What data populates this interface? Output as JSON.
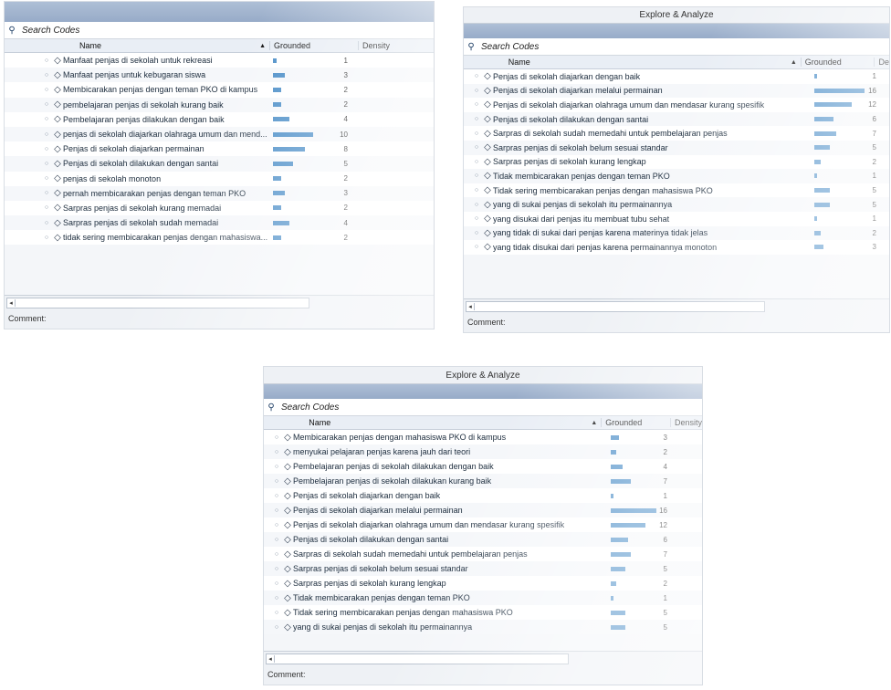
{
  "screenshots": [
    {
      "title": "",
      "search_label": "Search Codes",
      "columns": {
        "name": "Name",
        "grounded": "Grounded",
        "density": "Density"
      },
      "comment_label": "Comment:",
      "rows": [
        {
          "name": "Manfaat penjas di sekolah untuk rekreasi",
          "grounded": 1
        },
        {
          "name": "Manfaat penjas untuk kebugaran siswa",
          "grounded": 3
        },
        {
          "name": "Membicarakan penjas dengan teman PKO di kampus",
          "grounded": 2
        },
        {
          "name": "pembelajaran penjas di sekolah kurang baik",
          "grounded": 2
        },
        {
          "name": "Pembelajaran penjas dilakukan dengan baik",
          "grounded": 4
        },
        {
          "name": "penjas di sekolah diajarkan olahraga umum dan mend...",
          "grounded": 10
        },
        {
          "name": "Penjas di sekolah diajarkan permainan",
          "grounded": 8
        },
        {
          "name": "Penjas di sekolah dilakukan dengan santai",
          "grounded": 5
        },
        {
          "name": "penjas di sekolah monoton",
          "grounded": 2
        },
        {
          "name": "pernah membicarakan penjas dengan teman PKO",
          "grounded": 3
        },
        {
          "name": "Sarpras penjas di sekolah kurang memadai",
          "grounded": 2
        },
        {
          "name": "Sarpras penjas di sekolah sudah memadai",
          "grounded": 4
        },
        {
          "name": "tidak sering membicarakan penjas dengan mahasiswa...",
          "grounded": 2
        }
      ]
    },
    {
      "title": "Explore & Analyze",
      "search_label": "Search Codes",
      "columns": {
        "name": "Name",
        "grounded": "Grounded",
        "density": "De"
      },
      "comment_label": "Comment:",
      "rows": [
        {
          "name": "Penjas di sekolah diajarkan dengan baik",
          "grounded": 1
        },
        {
          "name": "Penjas di sekolah diajarkan melalui permainan",
          "grounded": 16
        },
        {
          "name": "Penjas di sekolah diajarkan olahraga umum dan mendasar kurang spesifik",
          "grounded": 12
        },
        {
          "name": "Penjas di sekolah dilakukan dengan santai",
          "grounded": 6
        },
        {
          "name": "Sarpras di sekolah sudah memedahi untuk pembelajaran penjas",
          "grounded": 7
        },
        {
          "name": "Sarpras penjas di sekolah belum sesuai standar",
          "grounded": 5
        },
        {
          "name": "Sarpras penjas di sekolah kurang lengkap",
          "grounded": 2
        },
        {
          "name": "Tidak membicarakan penjas dengan teman PKO",
          "grounded": 1
        },
        {
          "name": "Tidak sering membicarakan penjas dengan mahasiswa PKO",
          "grounded": 5
        },
        {
          "name": "yang di sukai penjas di sekolah itu permainannya",
          "grounded": 5
        },
        {
          "name": "yang disukai dari penjas itu membuat tubu sehat",
          "grounded": 1
        },
        {
          "name": "yang tidak di sukai dari penjas karena materinya tidak jelas",
          "grounded": 2
        },
        {
          "name": "yang tidak disukai dari penjas karena permainannya monoton",
          "grounded": 3
        }
      ]
    },
    {
      "title": "Explore & Analyze",
      "search_label": "Search Codes",
      "columns": {
        "name": "Name",
        "grounded": "Grounded",
        "density": "Density"
      },
      "comment_label": "Comment:",
      "rows": [
        {
          "name": "Membicarakan penjas dengan mahasiswa PKO di kampus",
          "grounded": 3
        },
        {
          "name": "menyukai pelajaran penjas karena jauh dari teori",
          "grounded": 2
        },
        {
          "name": "Pembelajaran penjas di sekolah dilakukan dengan baik",
          "grounded": 4
        },
        {
          "name": "Pembelajaran penjas di sekolah dilakukan kurang baik",
          "grounded": 7
        },
        {
          "name": "Penjas di sekolah diajarkan dengan baik",
          "grounded": 1
        },
        {
          "name": "Penjas di sekolah diajarkan melalui permainan",
          "grounded": 16
        },
        {
          "name": "Penjas di sekolah diajarkan olahraga umum dan mendasar kurang spesifik",
          "grounded": 12
        },
        {
          "name": "Penjas di sekolah dilakukan dengan santai",
          "grounded": 6
        },
        {
          "name": "Sarpras di sekolah sudah memedahi untuk pembelajaran penjas",
          "grounded": 7
        },
        {
          "name": "Sarpras penjas di sekolah belum sesuai standar",
          "grounded": 5
        },
        {
          "name": "Sarpras penjas di sekolah kurang lengkap",
          "grounded": 2
        },
        {
          "name": "Tidak membicarakan penjas dengan teman PKO",
          "grounded": 1
        },
        {
          "name": "Tidak sering membicarakan penjas dengan mahasiswa PKO",
          "grounded": 5
        },
        {
          "name": "yang di sukai penjas di sekolah itu permainannya",
          "grounded": 5
        }
      ]
    }
  ],
  "icons": {
    "search": "magnifier-icon",
    "code": "diamond-icon",
    "sort": "sort-ascending-icon",
    "scroll": "scroll-left-icon"
  },
  "colors": {
    "bar": "#4d8fc8",
    "header_band": "#9fb3cf"
  }
}
